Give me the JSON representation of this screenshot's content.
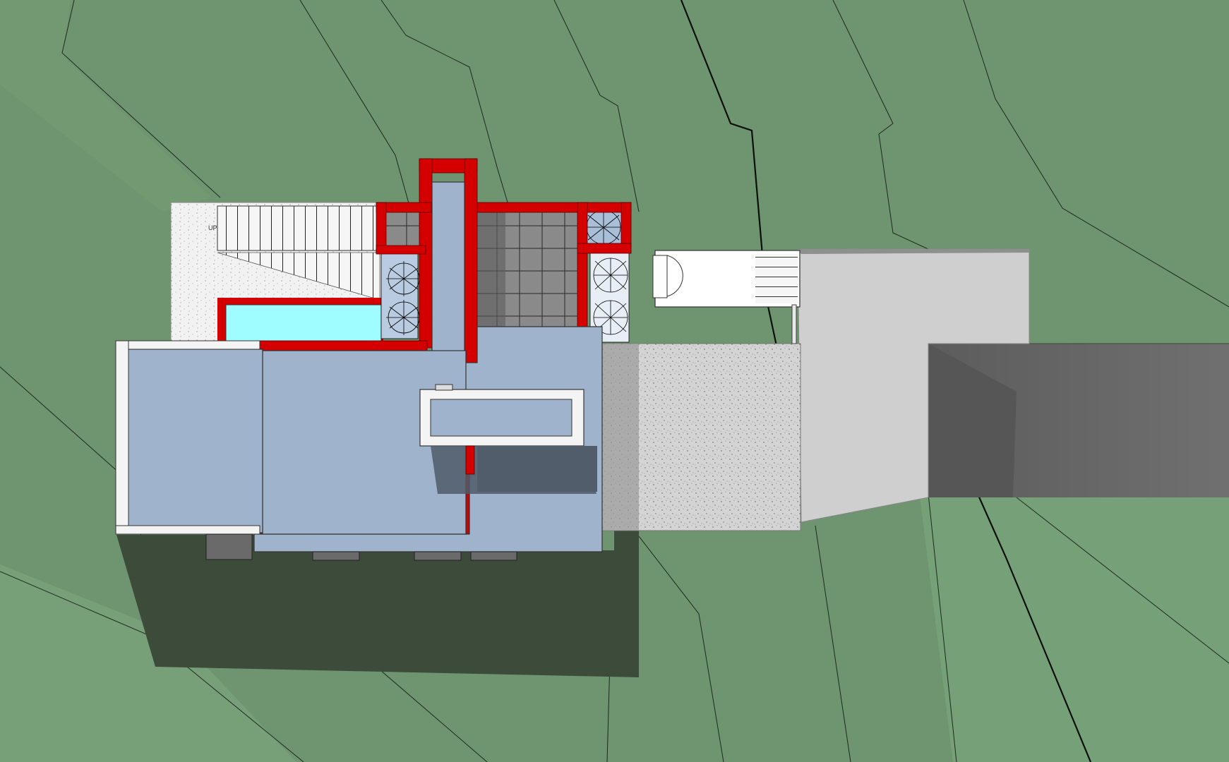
{
  "view": {
    "type": "3D top-down site plan view",
    "stair_label": "UP"
  },
  "colors": {
    "terrain": "#6e9470",
    "terrain_light": "#7fa27f",
    "shadow": "#3b4a38",
    "roof": "#9fb4cc",
    "wall_red": "#d40000",
    "pool": "#9ffcff",
    "concrete": "#d2d2d2",
    "gravel": "#c8c8c8",
    "road": "#6a6a6a",
    "tile": "#8a8a8a",
    "white": "#f4f4f4"
  }
}
